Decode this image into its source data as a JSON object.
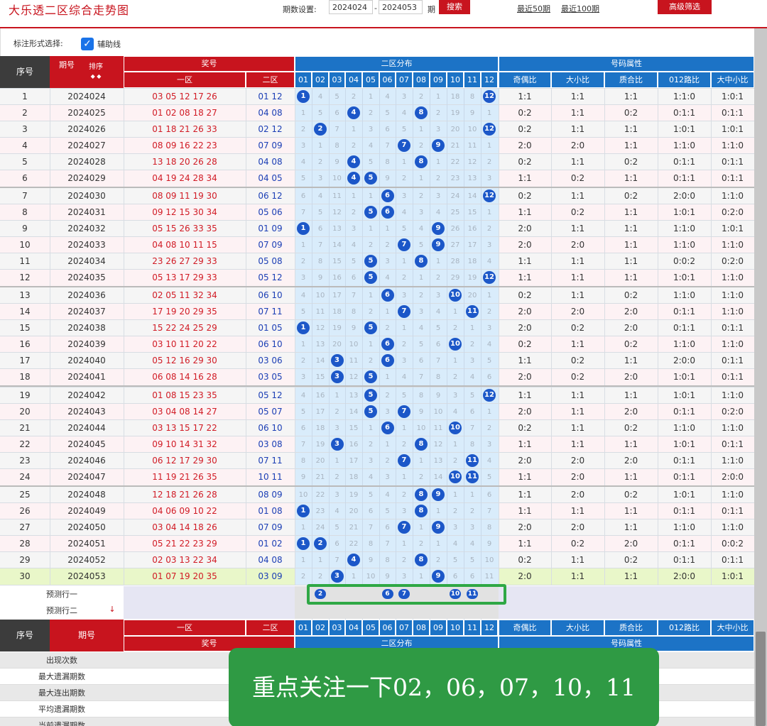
{
  "app_title": "大乐透二区综合走势图",
  "toolbar": {
    "period_label": "期数设置:",
    "from_value": "2024024",
    "dash": "-",
    "to_value": "2024053",
    "period_unit": "期",
    "search_label": "搜索",
    "recent50": "最近50期",
    "recent100": "最近100期",
    "advanced_filter": "高级筛选"
  },
  "options": {
    "label": "标注形式选择:",
    "aux_line_label": "辅助线",
    "aux_line_checked": true
  },
  "header": {
    "seq": "序号",
    "period": "期号",
    "sort": "排序",
    "sort_arrows": "◆ ◆",
    "prize_no": "奖号",
    "zone1": "一区",
    "zone2": "二区",
    "zone2_dist": "二区分布",
    "attr": "号码属性",
    "attr_cols": [
      "奇偶比",
      "大小比",
      "质合比",
      "012路比",
      "大中小比"
    ],
    "numbers": [
      "01",
      "02",
      "03",
      "04",
      "05",
      "06",
      "07",
      "08",
      "09",
      "10",
      "11",
      "12"
    ]
  },
  "rows": [
    {
      "seq": "1",
      "period": "2024024",
      "front": "03 05 12 17 26",
      "back": "01 12",
      "dist": [
        "b1",
        "4",
        "5",
        "2",
        "1",
        "4",
        "3",
        "2",
        "1",
        "18",
        "8",
        "b12"
      ],
      "attr": [
        "1:1",
        "1:1",
        "1:1",
        "1:1:0",
        "1:0:1"
      ]
    },
    {
      "seq": "2",
      "period": "2024025",
      "front": "01 02 08 18 27",
      "back": "04 08",
      "dist": [
        "1",
        "5",
        "6",
        "b4",
        "2",
        "5",
        "4",
        "b8",
        "2",
        "19",
        "9",
        "1"
      ],
      "attr": [
        "0:2",
        "1:1",
        "0:2",
        "0:1:1",
        "0:1:1"
      ]
    },
    {
      "seq": "3",
      "period": "2024026",
      "front": "01 18 21 26 33",
      "back": "02 12",
      "dist": [
        "2",
        "b2",
        "7",
        "1",
        "3",
        "6",
        "5",
        "1",
        "3",
        "20",
        "10",
        "b12"
      ],
      "attr": [
        "0:2",
        "1:1",
        "1:1",
        "1:0:1",
        "1:0:1"
      ]
    },
    {
      "seq": "4",
      "period": "2024027",
      "front": "08 09 16 22 23",
      "back": "07 09",
      "dist": [
        "3",
        "1",
        "8",
        "2",
        "4",
        "7",
        "b7",
        "2",
        "b9",
        "21",
        "11",
        "1"
      ],
      "attr": [
        "2:0",
        "2:0",
        "1:1",
        "1:1:0",
        "1:1:0"
      ]
    },
    {
      "seq": "5",
      "period": "2024028",
      "front": "13 18 20 26 28",
      "back": "04 08",
      "dist": [
        "4",
        "2",
        "9",
        "b4",
        "5",
        "8",
        "1",
        "b8",
        "1",
        "22",
        "12",
        "2"
      ],
      "attr": [
        "0:2",
        "1:1",
        "0:2",
        "0:1:1",
        "0:1:1"
      ]
    },
    {
      "seq": "6",
      "period": "2024029",
      "front": "04 19 24 28 34",
      "back": "04 05",
      "dist": [
        "5",
        "3",
        "10",
        "b4",
        "b5",
        "9",
        "2",
        "1",
        "2",
        "23",
        "13",
        "3"
      ],
      "attr": [
        "1:1",
        "0:2",
        "1:1",
        "0:1:1",
        "0:1:1"
      ]
    },
    {
      "seq": "7",
      "period": "2024030",
      "front": "08 09 11 19 30",
      "back": "06 12",
      "dist": [
        "6",
        "4",
        "11",
        "1",
        "1",
        "b6",
        "3",
        "2",
        "3",
        "24",
        "14",
        "b12"
      ],
      "attr": [
        "0:2",
        "1:1",
        "0:2",
        "2:0:0",
        "1:1:0"
      ]
    },
    {
      "seq": "8",
      "period": "2024031",
      "front": "09 12 15 30 34",
      "back": "05 06",
      "dist": [
        "7",
        "5",
        "12",
        "2",
        "b5",
        "b6",
        "4",
        "3",
        "4",
        "25",
        "15",
        "1"
      ],
      "attr": [
        "1:1",
        "0:2",
        "1:1",
        "1:0:1",
        "0:2:0"
      ]
    },
    {
      "seq": "9",
      "period": "2024032",
      "front": "05 15 26 33 35",
      "back": "01 09",
      "dist": [
        "b1",
        "6",
        "13",
        "3",
        "1",
        "1",
        "5",
        "4",
        "b9",
        "26",
        "16",
        "2"
      ],
      "attr": [
        "2:0",
        "1:1",
        "1:1",
        "1:1:0",
        "1:0:1"
      ]
    },
    {
      "seq": "10",
      "period": "2024033",
      "front": "04 08 10 11 15",
      "back": "07 09",
      "dist": [
        "1",
        "7",
        "14",
        "4",
        "2",
        "2",
        "b7",
        "5",
        "b9",
        "27",
        "17",
        "3"
      ],
      "attr": [
        "2:0",
        "2:0",
        "1:1",
        "1:1:0",
        "1:1:0"
      ]
    },
    {
      "seq": "11",
      "period": "2024034",
      "front": "23 26 27 29 33",
      "back": "05 08",
      "dist": [
        "2",
        "8",
        "15",
        "5",
        "b5",
        "3",
        "1",
        "b8",
        "1",
        "28",
        "18",
        "4"
      ],
      "attr": [
        "1:1",
        "1:1",
        "1:1",
        "0:0:2",
        "0:2:0"
      ]
    },
    {
      "seq": "12",
      "period": "2024035",
      "front": "05 13 17 29 33",
      "back": "05 12",
      "dist": [
        "3",
        "9",
        "16",
        "6",
        "b5",
        "4",
        "2",
        "1",
        "2",
        "29",
        "19",
        "b12"
      ],
      "attr": [
        "1:1",
        "1:1",
        "1:1",
        "1:0:1",
        "1:1:0"
      ]
    },
    {
      "seq": "13",
      "period": "2024036",
      "front": "02 05 11 32 34",
      "back": "06 10",
      "dist": [
        "4",
        "10",
        "17",
        "7",
        "1",
        "b6",
        "3",
        "2",
        "3",
        "b10",
        "20",
        "1"
      ],
      "attr": [
        "0:2",
        "1:1",
        "0:2",
        "1:1:0",
        "1:1:0"
      ]
    },
    {
      "seq": "14",
      "period": "2024037",
      "front": "17 19 20 29 35",
      "back": "07 11",
      "dist": [
        "5",
        "11",
        "18",
        "8",
        "2",
        "1",
        "b7",
        "3",
        "4",
        "1",
        "b11",
        "2"
      ],
      "attr": [
        "2:0",
        "2:0",
        "2:0",
        "0:1:1",
        "1:1:0"
      ]
    },
    {
      "seq": "15",
      "period": "2024038",
      "front": "15 22 24 25 29",
      "back": "01 05",
      "dist": [
        "b1",
        "12",
        "19",
        "9",
        "b5",
        "2",
        "1",
        "4",
        "5",
        "2",
        "1",
        "3"
      ],
      "attr": [
        "2:0",
        "0:2",
        "2:0",
        "0:1:1",
        "0:1:1"
      ]
    },
    {
      "seq": "16",
      "period": "2024039",
      "front": "03 10 11 20 22",
      "back": "06 10",
      "dist": [
        "1",
        "13",
        "20",
        "10",
        "1",
        "b6",
        "2",
        "5",
        "6",
        "b10",
        "2",
        "4"
      ],
      "attr": [
        "0:2",
        "1:1",
        "0:2",
        "1:1:0",
        "1:1:0"
      ]
    },
    {
      "seq": "17",
      "period": "2024040",
      "front": "05 12 16 29 30",
      "back": "03 06",
      "dist": [
        "2",
        "14",
        "b3",
        "11",
        "2",
        "b6",
        "3",
        "6",
        "7",
        "1",
        "3",
        "5"
      ],
      "attr": [
        "1:1",
        "0:2",
        "1:1",
        "2:0:0",
        "0:1:1"
      ]
    },
    {
      "seq": "18",
      "period": "2024041",
      "front": "06 08 14 16 28",
      "back": "03 05",
      "dist": [
        "3",
        "15",
        "b3",
        "12",
        "b5",
        "1",
        "4",
        "7",
        "8",
        "2",
        "4",
        "6"
      ],
      "attr": [
        "2:0",
        "0:2",
        "2:0",
        "1:0:1",
        "0:1:1"
      ]
    },
    {
      "seq": "19",
      "period": "2024042",
      "front": "01 08 15 23 35",
      "back": "05 12",
      "dist": [
        "4",
        "16",
        "1",
        "13",
        "b5",
        "2",
        "5",
        "8",
        "9",
        "3",
        "5",
        "b12"
      ],
      "attr": [
        "1:1",
        "1:1",
        "1:1",
        "1:0:1",
        "1:1:0"
      ]
    },
    {
      "seq": "20",
      "period": "2024043",
      "front": "03 04 08 14 27",
      "back": "05 07",
      "dist": [
        "5",
        "17",
        "2",
        "14",
        "b5",
        "3",
        "b7",
        "9",
        "10",
        "4",
        "6",
        "1"
      ],
      "attr": [
        "2:0",
        "1:1",
        "2:0",
        "0:1:1",
        "0:2:0"
      ]
    },
    {
      "seq": "21",
      "period": "2024044",
      "front": "03 13 15 17 22",
      "back": "06 10",
      "dist": [
        "6",
        "18",
        "3",
        "15",
        "1",
        "b6",
        "1",
        "10",
        "11",
        "b10",
        "7",
        "2"
      ],
      "attr": [
        "0:2",
        "1:1",
        "0:2",
        "1:1:0",
        "1:1:0"
      ]
    },
    {
      "seq": "22",
      "period": "2024045",
      "front": "09 10 14 31 32",
      "back": "03 08",
      "dist": [
        "7",
        "19",
        "b3",
        "16",
        "2",
        "1",
        "2",
        "b8",
        "12",
        "1",
        "8",
        "3"
      ],
      "attr": [
        "1:1",
        "1:1",
        "1:1",
        "1:0:1",
        "0:1:1"
      ]
    },
    {
      "seq": "23",
      "period": "2024046",
      "front": "06 12 17 29 30",
      "back": "07 11",
      "dist": [
        "8",
        "20",
        "1",
        "17",
        "3",
        "2",
        "b7",
        "1",
        "13",
        "2",
        "b11",
        "4"
      ],
      "attr": [
        "2:0",
        "2:0",
        "2:0",
        "0:1:1",
        "1:1:0"
      ]
    },
    {
      "seq": "24",
      "period": "2024047",
      "front": "11 19 21 26 35",
      "back": "10 11",
      "dist": [
        "9",
        "21",
        "2",
        "18",
        "4",
        "3",
        "1",
        "2",
        "14",
        "b10",
        "b11",
        "5"
      ],
      "attr": [
        "1:1",
        "2:0",
        "1:1",
        "0:1:1",
        "2:0:0"
      ]
    },
    {
      "seq": "25",
      "period": "2024048",
      "front": "12 18 21 26 28",
      "back": "08 09",
      "dist": [
        "10",
        "22",
        "3",
        "19",
        "5",
        "4",
        "2",
        "b8",
        "b9",
        "1",
        "1",
        "6"
      ],
      "attr": [
        "1:1",
        "2:0",
        "0:2",
        "1:0:1",
        "1:1:0"
      ]
    },
    {
      "seq": "26",
      "period": "2024049",
      "front": "04 06 09 10 22",
      "back": "01 08",
      "dist": [
        "b1",
        "23",
        "4",
        "20",
        "6",
        "5",
        "3",
        "b8",
        "1",
        "2",
        "2",
        "7"
      ],
      "attr": [
        "1:1",
        "1:1",
        "1:1",
        "0:1:1",
        "0:1:1"
      ]
    },
    {
      "seq": "27",
      "period": "2024050",
      "front": "03 04 14 18 26",
      "back": "07 09",
      "dist": [
        "1",
        "24",
        "5",
        "21",
        "7",
        "6",
        "b7",
        "1",
        "b9",
        "3",
        "3",
        "8"
      ],
      "attr": [
        "2:0",
        "2:0",
        "1:1",
        "1:1:0",
        "1:1:0"
      ]
    },
    {
      "seq": "28",
      "period": "2024051",
      "front": "05 21 22 23 29",
      "back": "01 02",
      "dist": [
        "b1",
        "b2",
        "6",
        "22",
        "8",
        "7",
        "1",
        "2",
        "1",
        "4",
        "4",
        "9"
      ],
      "attr": [
        "1:1",
        "0:2",
        "2:0",
        "0:1:1",
        "0:0:2"
      ]
    },
    {
      "seq": "29",
      "period": "2024052",
      "front": "02 03 13 22 34",
      "back": "04 08",
      "dist": [
        "1",
        "1",
        "7",
        "b4",
        "9",
        "8",
        "2",
        "b8",
        "2",
        "5",
        "5",
        "10"
      ],
      "attr": [
        "0:2",
        "1:1",
        "0:2",
        "0:1:1",
        "0:1:1"
      ]
    },
    {
      "seq": "30",
      "period": "2024053",
      "front": "01 07 19 20 35",
      "back": "03 09",
      "dist": [
        "2",
        "2",
        "b3",
        "1",
        "10",
        "9",
        "3",
        "1",
        "b9",
        "6",
        "6",
        "11"
      ],
      "attr": [
        "2:0",
        "1:1",
        "1:1",
        "2:0:0",
        "1:0:1"
      ]
    }
  ],
  "predict": {
    "row1_label": "预测行一",
    "row2_label": "预测行二",
    "row2_arrow": "↓",
    "row1_balls": [
      "2",
      "6",
      "7",
      "10",
      "11"
    ]
  },
  "footer_header": {
    "seq": "序号",
    "period": "期号",
    "zone1": "一区",
    "zone2": "二区",
    "prize_no": "奖号",
    "zone2_dist": "二区分布",
    "attr": "号码属性"
  },
  "stats": [
    "出现次数",
    "最大遗漏期数",
    "最大连出期数",
    "平均遗漏期数",
    "当前遗漏期数"
  ],
  "overlay_text": "重点关注一下02，06，07，10，11",
  "colors": {
    "red": "#c8141e",
    "blue": "#1c73c6",
    "ball": "#1c57c8",
    "zone_bg": "#d9ecfb",
    "overlay": "#2f9a44"
  }
}
